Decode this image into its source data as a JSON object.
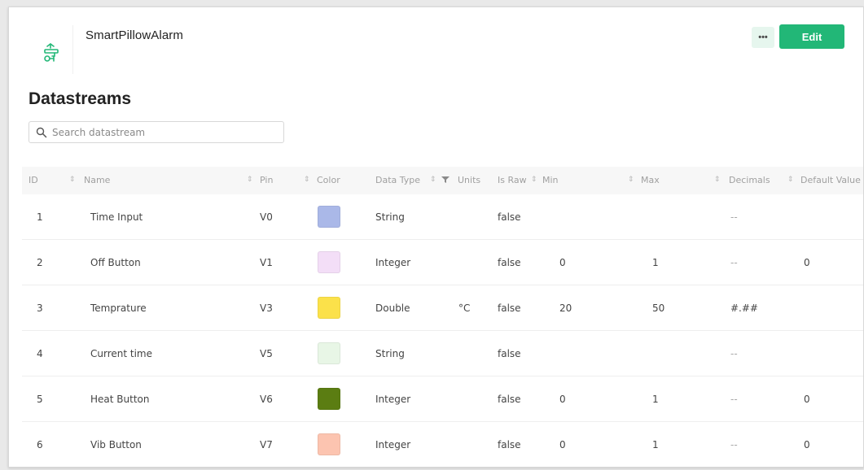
{
  "device": {
    "name": "SmartPillowAlarm",
    "logo_icon": "smart-pillow-logo-icon"
  },
  "actions": {
    "more_label": "•••",
    "edit_label": "Edit"
  },
  "page_title": "Datastreams",
  "search": {
    "placeholder": "Search datastream",
    "value": ""
  },
  "table": {
    "columns": [
      "ID",
      "Name",
      "Pin",
      "Color",
      "Data Type",
      "Units",
      "Is Raw",
      "Min",
      "Max",
      "Decimals",
      "Default Value"
    ],
    "sort_glyph": "⇕",
    "rows": [
      {
        "id": "1",
        "name": "Time Input",
        "pin": "V0",
        "color": "#aab8e8",
        "data_type": "String",
        "units": "",
        "is_raw": "false",
        "min": "",
        "max": "",
        "decimals": "--",
        "default": ""
      },
      {
        "id": "2",
        "name": "Off Button",
        "pin": "V1",
        "color": "#f3def7",
        "data_type": "Integer",
        "units": "",
        "is_raw": "false",
        "min": "0",
        "max": "1",
        "decimals": "--",
        "default": "0"
      },
      {
        "id": "3",
        "name": "Temprature",
        "pin": "V3",
        "color": "#fbe14a",
        "data_type": "Double",
        "units": "°C",
        "is_raw": "false",
        "min": "20",
        "max": "50",
        "decimals": "#.##",
        "default": ""
      },
      {
        "id": "4",
        "name": "Current time",
        "pin": "V5",
        "color": "#e8f6e6",
        "data_type": "String",
        "units": "",
        "is_raw": "false",
        "min": "",
        "max": "",
        "decimals": "--",
        "default": ""
      },
      {
        "id": "5",
        "name": "Heat Button",
        "pin": "V6",
        "color": "#5b7d12",
        "data_type": "Integer",
        "units": "",
        "is_raw": "false",
        "min": "0",
        "max": "1",
        "decimals": "--",
        "default": "0"
      },
      {
        "id": "6",
        "name": "Vib Button",
        "pin": "V7",
        "color": "#fcc4b0",
        "data_type": "Integer",
        "units": "",
        "is_raw": "false",
        "min": "0",
        "max": "1",
        "decimals": "--",
        "default": "0"
      }
    ]
  },
  "colors": {
    "accent": "#22b777",
    "more_bg": "#e6f6ee"
  }
}
